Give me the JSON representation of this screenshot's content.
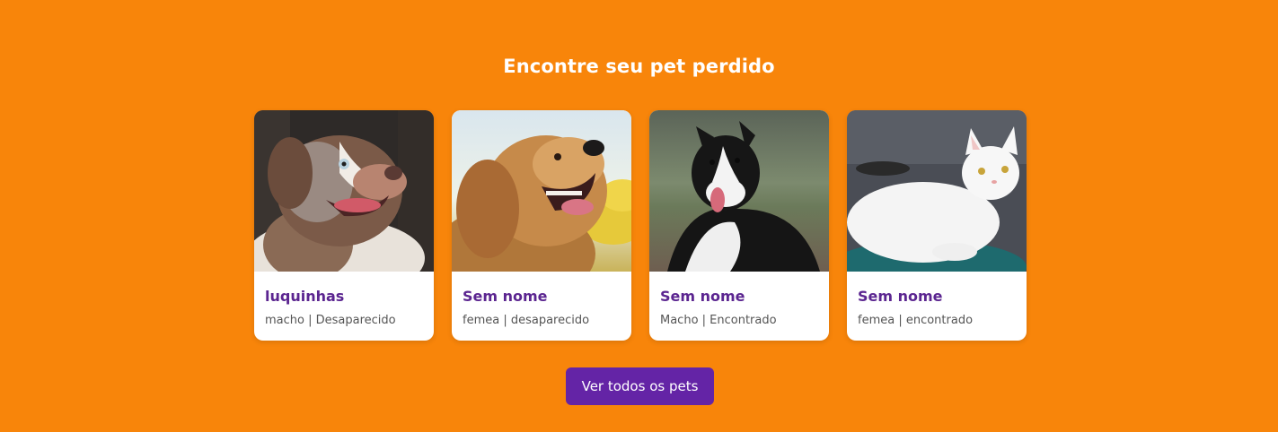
{
  "page": {
    "title": "Encontre seu pet perdido",
    "button_label": "Ver todos os pets"
  },
  "colors": {
    "background": "#F8850A",
    "card_title": "#5B2590",
    "button": "#6424A6"
  },
  "pets": [
    {
      "name": "luquinhas",
      "info": "macho | Desaparecido",
      "image": "australian-shepherd-dog-photo"
    },
    {
      "name": "Sem nome",
      "info": "femea | desaparecido",
      "image": "golden-retriever-dog-photo"
    },
    {
      "name": "Sem nome",
      "info": "Macho | Encontrado",
      "image": "border-collie-dog-photo"
    },
    {
      "name": "Sem nome",
      "info": "femea | encontrado",
      "image": "white-cat-photo"
    }
  ]
}
